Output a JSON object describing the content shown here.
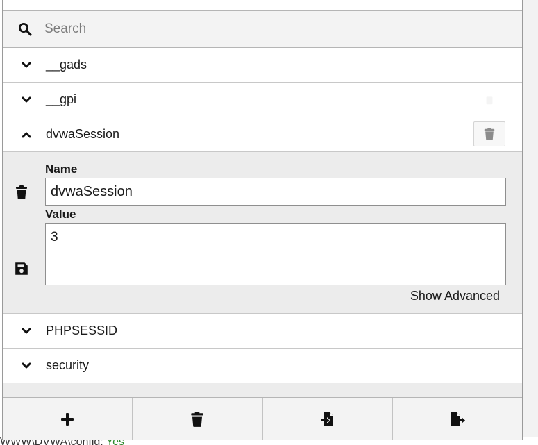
{
  "search": {
    "placeholder": "Search"
  },
  "cookies": [
    {
      "name": "__gads",
      "expanded": false
    },
    {
      "name": "__gpi",
      "expanded": false
    },
    {
      "name": "dvwaSession",
      "expanded": true
    },
    {
      "name": "PHPSESSID",
      "expanded": false
    },
    {
      "name": "security",
      "expanded": false
    }
  ],
  "editor": {
    "name_label": "Name",
    "name_value": "dvwaSession",
    "value_label": "Value",
    "value_value": "3",
    "advanced_link": "Show Advanced"
  },
  "toolbar": {
    "add_icon": "plus-icon",
    "delete_all_icon": "trash-icon",
    "import_icon": "file-import-icon",
    "export_icon": "file-export-icon"
  },
  "background_page": {
    "text_prefix": "WWW\\DVWA\\config: ",
    "text_status": "Yes"
  },
  "colors": {
    "panel_bg": "#ececec",
    "border": "#b5b5b5",
    "status_ok": "#2e8b2e"
  }
}
